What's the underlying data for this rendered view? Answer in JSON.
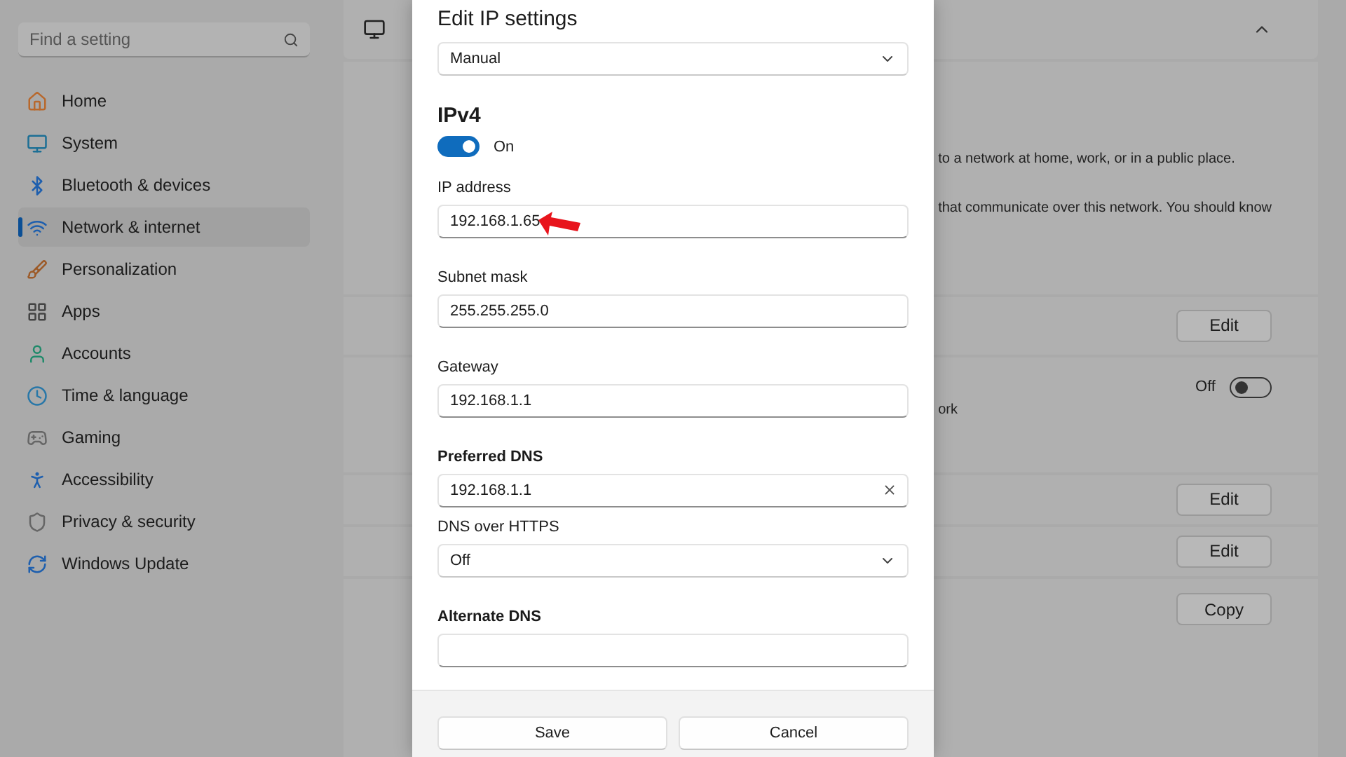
{
  "sidebar": {
    "search": {
      "placeholder": "Find a setting"
    },
    "items": [
      {
        "label": "Home",
        "selected": false
      },
      {
        "label": "System",
        "selected": false
      },
      {
        "label": "Bluetooth & devices",
        "selected": false
      },
      {
        "label": "Network & internet",
        "selected": true
      },
      {
        "label": "Personalization",
        "selected": false
      },
      {
        "label": "Apps",
        "selected": false
      },
      {
        "label": "Accounts",
        "selected": false
      },
      {
        "label": "Time & language",
        "selected": false
      },
      {
        "label": "Gaming",
        "selected": false
      },
      {
        "label": "Accessibility",
        "selected": false
      },
      {
        "label": "Privacy & security",
        "selected": false
      },
      {
        "label": "Windows Update",
        "selected": false
      }
    ]
  },
  "background": {
    "sections": [
      {
        "kind": "header"
      },
      {
        "kind": "lines",
        "lines": [
          "to a network at home, work, or in a public place.",
          "that communicate over this network. You should know"
        ]
      },
      {
        "kind": "button",
        "button": "Edit"
      },
      {
        "kind": "toggle",
        "note": "ork",
        "state_label": "Off",
        "on": false
      },
      {
        "kind": "button",
        "button": "Edit"
      },
      {
        "kind": "button",
        "button": "Edit"
      },
      {
        "kind": "list",
        "button": "Copy"
      }
    ]
  },
  "dialog": {
    "title": "Edit IP settings",
    "mode": "Manual",
    "section": "IPv4",
    "toggle": {
      "on": true,
      "label": "On"
    },
    "fields": [
      {
        "kind": "text",
        "label": "IP address",
        "strong": false,
        "value": "192.168.1.65",
        "pointer": true
      },
      {
        "kind": "text",
        "label": "Subnet mask",
        "strong": false,
        "value": "255.255.255.0",
        "pointer": false
      },
      {
        "kind": "text",
        "label": "Gateway",
        "strong": false,
        "value": "192.168.1.1",
        "pointer": false
      },
      {
        "kind": "clearable",
        "label": "Preferred DNS",
        "strong": true,
        "value": "192.168.1.1",
        "pointer": false
      },
      {
        "kind": "dropdown",
        "label": "DNS over HTTPS",
        "strong": false,
        "value": "Off",
        "pointer": false
      },
      {
        "kind": "text",
        "label": "Alternate DNS",
        "strong": true,
        "pointer": false
      }
    ],
    "buttons": [
      "Save",
      "Cancel"
    ]
  }
}
